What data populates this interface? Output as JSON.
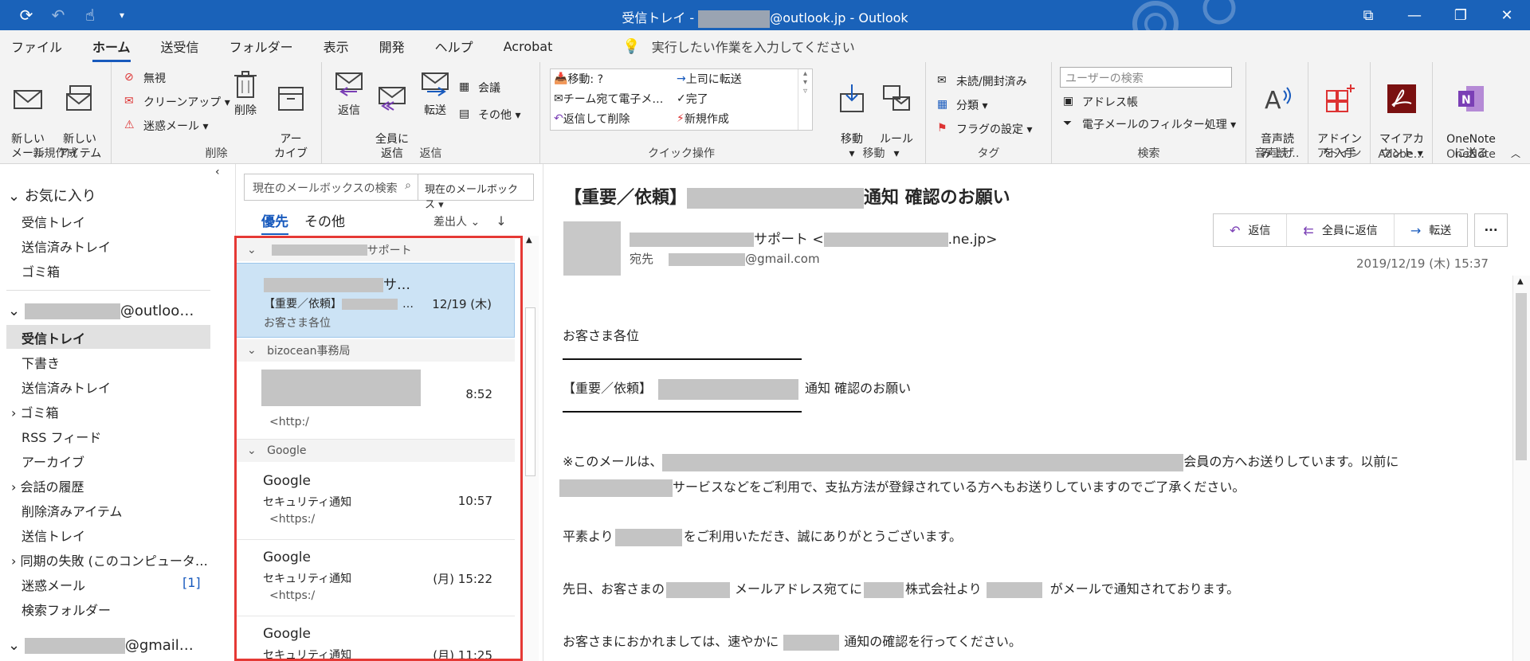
{
  "window": {
    "title_prefix": "受信トレイ - ",
    "title_suffix": "@outlook.jp  -  Outlook"
  },
  "menu": {
    "items": [
      "ファイル",
      "ホーム",
      "送受信",
      "フォルダー",
      "表示",
      "開発",
      "ヘルプ",
      "Acrobat"
    ],
    "active": "ホーム",
    "tell_me": "実行したい作業を入力してください"
  },
  "ribbon": {
    "new_mail": "新しい\nメール",
    "new_item": "新しい\nアイテム ▾",
    "group_new": "新規作成",
    "ignore": "無視",
    "cleanup": "クリーンアップ ▾",
    "junk": "迷惑メール ▾",
    "delete": "削除",
    "archive": "アー\nカイブ",
    "group_delete": "削除",
    "reply": "返信",
    "reply_all": "全員に\n返信",
    "forward": "転送",
    "meeting": "会議",
    "more": "その他 ▾",
    "group_respond": "返信",
    "qs_move": "移動: ?",
    "qs_team": "チーム宛て電子メ…",
    "qs_reply_delete": "返信して削除",
    "qs_to_manager": "上司に転送",
    "qs_done": "完了",
    "qs_create_new": "新規作成",
    "group_quicksteps": "クイック操作",
    "move": "移動\n▾",
    "rules": "ルール\n▾",
    "group_move": "移動",
    "unread_read": "未読/開封済み",
    "categorize": "分類 ▾",
    "follow_up": "フラグの設定 ▾",
    "group_tags": "タグ",
    "user_search_placeholder": "ユーザーの検索",
    "address_book": "アドレス帳",
    "filter_mail": "電子メールのフィルター処理 ▾",
    "group_find": "検索",
    "read_aloud": "音声読\nみ上げ",
    "group_speech": "音声読…",
    "get_addins": "アドイン\nを入手",
    "group_addins": "アドイン",
    "my_account": "マイアカ\nウント ▾",
    "group_adobe": "Adobe…",
    "send_onenote": "OneNote\nに送る",
    "group_onenote": "OneNote"
  },
  "folders": {
    "favorites_header": "お気に入り",
    "favorites": [
      "受信トレイ",
      "送信済みトレイ",
      "ゴミ箱"
    ],
    "account1_suffix": "@outloo…",
    "account1_items": [
      "受信トレイ",
      "下書き",
      "送信済みトレイ",
      "ゴミ箱",
      "RSS フィード",
      "アーカイブ",
      "会話の履歴",
      "削除済みアイテム",
      "送信トレイ",
      "同期の失敗 (このコンピュータ…",
      "迷惑メール",
      "検索フォルダー"
    ],
    "junk_count": "[1]",
    "account2_suffix": "@gmail…"
  },
  "list": {
    "search_placeholder": "現在のメールボックスの検索",
    "scope": "現在のメールボックス",
    "tab_focused": "優先",
    "tab_other": "その他",
    "sort": "差出人 ⌄",
    "groups": [
      {
        "header": "サポート"
      },
      {
        "header": "bizocean事務局"
      },
      {
        "header": "Google"
      }
    ],
    "messages": [
      {
        "sender_suffix": "サ…",
        "subject": "【重要／依頼】",
        "subject_tail": "…",
        "time": "12/19 (木)",
        "preview": "お客さま各位"
      },
      {
        "time": "8:52",
        "preview": "<http:/"
      },
      {
        "sender": "Google",
        "subject": "セキュリティ通知",
        "time": "10:57",
        "preview": "<https:/"
      },
      {
        "sender": "Google",
        "subject": "セキュリティ通知",
        "time": "(月) 15:22",
        "preview": "<https:/"
      },
      {
        "sender": "Google",
        "subject": "セキュリティ通知",
        "time": "(月) 11:25"
      }
    ]
  },
  "reading": {
    "subject_prefix": "【重要／依頼】",
    "subject_suffix": "通知  確認のお願い",
    "from_suffix": "サポート <",
    "from_domain": ".ne.jp>",
    "to_label": "宛先",
    "to_suffix": "@gmail.com",
    "reply": "返信",
    "reply_all": "全員に返信",
    "forward": "転送",
    "more": "···",
    "date": "2019/12/19 (木) 15:37",
    "body": {
      "greeting": "お客さま各位",
      "title_prefix": "【重要／依頼】",
      "title_suffix": "通知    確認のお願い",
      "p1_prefix": "※このメールは、",
      "p1_suffix": "会員の方へお送りしています。以前に",
      "p1b_suffix": "サービスなどをご利用で、支払方法が登録されている方へもお送りしていますのでご了承ください。",
      "p2_prefix": "平素より",
      "p2_suffix": "をご利用いただき、誠にありがとうございます。",
      "p3_a": "先日、お客さまの",
      "p3_b": "メールアドレス宛てに",
      "p3_c": "株式会社より",
      "p3_d": "がメールで通知されております。",
      "p4_prefix": "お客さまにおかれましては、速やかに",
      "p4_suffix": "通知の確認を行ってください。"
    }
  },
  "colors": {
    "titlebar": "#1a62b9",
    "accent": "#185abd",
    "selection": "#cce3f5",
    "highlight_box": "#e53935"
  }
}
